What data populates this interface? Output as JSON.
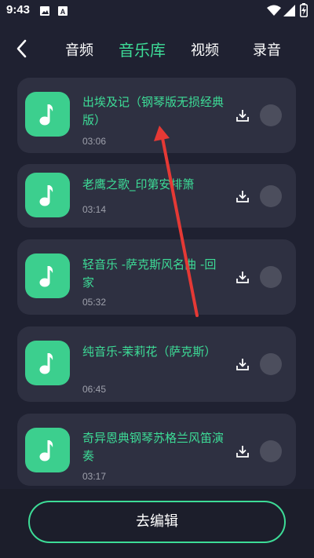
{
  "status_bar": {
    "time": "9:43"
  },
  "header": {
    "tabs": [
      {
        "label": "音频",
        "active": false
      },
      {
        "label": "音乐库",
        "active": true
      },
      {
        "label": "视频",
        "active": false
      },
      {
        "label": "录音",
        "active": false
      }
    ]
  },
  "tracks": [
    {
      "title": "出埃及记（钢琴版无损经典版）",
      "duration": "03:06",
      "selected": false
    },
    {
      "title": "老鹰之歌_印第安排箫",
      "duration": "03:14",
      "selected": false
    },
    {
      "title": "轻音乐 -萨克斯风名曲 -回家",
      "duration": "05:32",
      "selected": false
    },
    {
      "title": "纯音乐-茉莉花（萨克斯）",
      "duration": "06:45",
      "selected": false
    },
    {
      "title": "奇异恩典钢琴苏格兰风笛演奏",
      "duration": "03:17",
      "selected": false
    }
  ],
  "bottom": {
    "edit_button_label": "去编辑"
  },
  "colors": {
    "accent": "#3ddc97",
    "background": "#1f2131",
    "card": "#2e3041",
    "annotation_arrow": "#e53935"
  },
  "icons": {
    "back": "chevron-left-icon",
    "music": "music-note-icon",
    "download": "download-icon",
    "select": "radio-circle-icon",
    "status": [
      "image-icon",
      "app-icon",
      "wifi-icon",
      "signal-icon",
      "battery-charging-icon"
    ]
  }
}
